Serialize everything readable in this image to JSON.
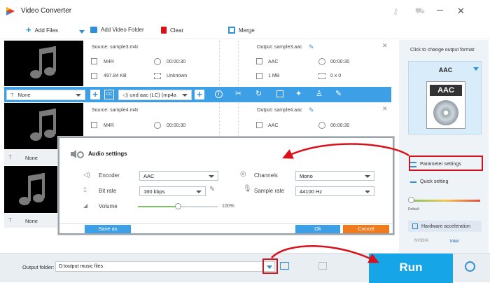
{
  "app": {
    "title": "Video Converter"
  },
  "toolbar": {
    "add_files": "Add Files",
    "add_video_folder": "Add Video Folder",
    "clear": "Clear",
    "merge": "Merge"
  },
  "files": [
    {
      "source": "Source: sample3.m4r",
      "src_format": "M4R",
      "src_duration": "00:00:30",
      "src_size": "497.84 KB",
      "src_res": "Unknown",
      "output": "Output: sample3.aac",
      "out_format": "AAC",
      "out_duration": "00:00:30",
      "out_size": "1 MB",
      "out_res": "0 x 0",
      "subtitle": "None",
      "audio_track": "und aac (LC) (mp4a"
    },
    {
      "source": "Source: sample4.m4r",
      "src_format": "M4R",
      "src_duration": "00:00:30",
      "output": "Output: sample4.aac",
      "out_format": "AAC",
      "out_duration": "00:00:30",
      "subtitle": "None"
    },
    {
      "subtitle": "None"
    }
  ],
  "right_panel": {
    "caption": "Click to change output format:",
    "format": "AAC",
    "format_badge": "AAC",
    "parameter_settings": "Parameter settings",
    "quick_setting": "Quick setting",
    "default_label": "Default",
    "hw_accel": "Hardware acceleration",
    "nvidia": "NVIDIA",
    "intel": "Intel"
  },
  "dialog": {
    "title": "Audio settings",
    "encoder_label": "Encoder",
    "encoder_value": "AAC",
    "channels_label": "Channels",
    "channels_value": "Mono",
    "bitrate_label": "Bit rate",
    "bitrate_value": "160 kbps",
    "samplerate_label": "Sample rate",
    "samplerate_value": "44100 Hz",
    "volume_label": "Volume",
    "volume_value": "100%",
    "volume_level": 0.5,
    "save_as": "Save as",
    "ok": "Ok",
    "cancel": "Cancel"
  },
  "bottom": {
    "output_folder_label": "Output folder:",
    "output_folder_value": "D:\\output music files",
    "run": "Run"
  },
  "colors": {
    "accent": "#3d9fe6",
    "run": "#16a6e8",
    "annotation": "#d8121b",
    "cancel": "#f07b1f"
  }
}
